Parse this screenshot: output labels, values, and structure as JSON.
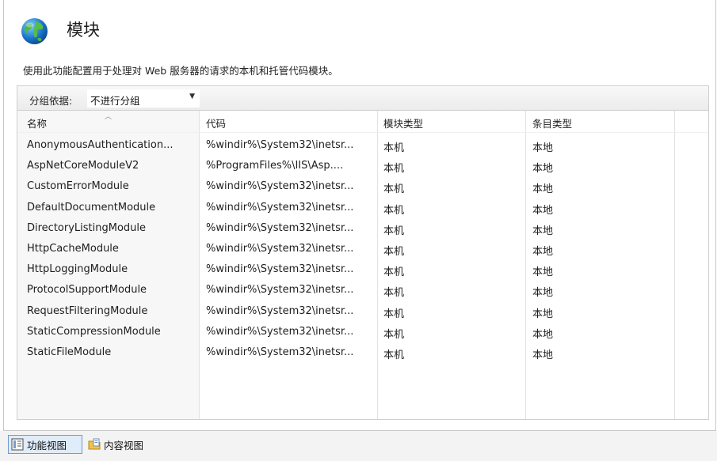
{
  "header": {
    "icon": "globe-icon",
    "title": "模块",
    "description": "使用此功能配置用于处理对 Web 服务器的请求的本机和托管代码模块。"
  },
  "toolbar": {
    "group_label": "分组依据:",
    "group_value": "不进行分组"
  },
  "table": {
    "columns": [
      "名称",
      "代码",
      "模块类型",
      "条目类型"
    ],
    "sorted_column": "名称",
    "rows": [
      {
        "name": "AnonymousAuthentication...",
        "code": "%windir%\\System32\\inetsr...",
        "module_type": "本机",
        "entry_type": "本地"
      },
      {
        "name": "AspNetCoreModuleV2",
        "code": "%ProgramFiles%\\IIS\\Asp....",
        "module_type": "本机",
        "entry_type": "本地"
      },
      {
        "name": "CustomErrorModule",
        "code": "%windir%\\System32\\inetsr...",
        "module_type": "本机",
        "entry_type": "本地"
      },
      {
        "name": "DefaultDocumentModule",
        "code": "%windir%\\System32\\inetsr...",
        "module_type": "本机",
        "entry_type": "本地"
      },
      {
        "name": "DirectoryListingModule",
        "code": "%windir%\\System32\\inetsr...",
        "module_type": "本机",
        "entry_type": "本地"
      },
      {
        "name": "HttpCacheModule",
        "code": "%windir%\\System32\\inetsr...",
        "module_type": "本机",
        "entry_type": "本地"
      },
      {
        "name": "HttpLoggingModule",
        "code": "%windir%\\System32\\inetsr...",
        "module_type": "本机",
        "entry_type": "本地"
      },
      {
        "name": "ProtocolSupportModule",
        "code": "%windir%\\System32\\inetsr...",
        "module_type": "本机",
        "entry_type": "本地"
      },
      {
        "name": "RequestFilteringModule",
        "code": "%windir%\\System32\\inetsr...",
        "module_type": "本机",
        "entry_type": "本地"
      },
      {
        "name": "StaticCompressionModule",
        "code": "%windir%\\System32\\inetsr...",
        "module_type": "本机",
        "entry_type": "本地"
      },
      {
        "name": "StaticFileModule",
        "code": "%windir%\\System32\\inetsr...",
        "module_type": "本机",
        "entry_type": "本地"
      }
    ]
  },
  "bottom_tabs": [
    {
      "label": "功能视图",
      "icon": "features-view-icon",
      "active": true
    },
    {
      "label": "内容视图",
      "icon": "content-view-icon",
      "active": false
    }
  ],
  "colors": {
    "active_tab_border": "#6f9bcf",
    "active_tab_bg": "#dfecf9"
  }
}
